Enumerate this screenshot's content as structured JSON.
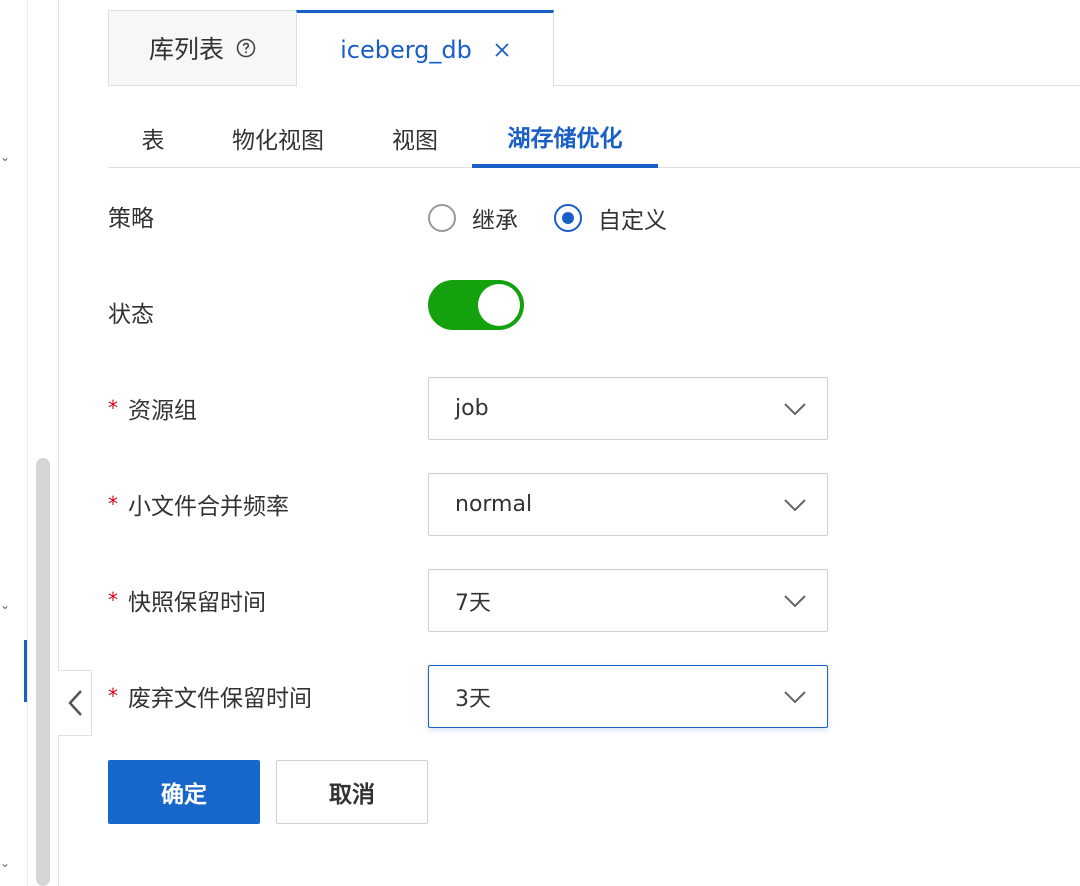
{
  "top_tabs": [
    {
      "label": "库列表"
    },
    {
      "label": "iceberg_db"
    }
  ],
  "sub_tabs": [
    {
      "label": "表"
    },
    {
      "label": "物化视图"
    },
    {
      "label": "视图"
    },
    {
      "label": "湖存储优化"
    }
  ],
  "active_sub_tab": "湖存储优化",
  "form": {
    "strategy": {
      "label": "策略",
      "options": [
        "继承",
        "自定义"
      ],
      "selected": "自定义"
    },
    "status": {
      "label": "状态",
      "enabled": true
    },
    "resource_group": {
      "required_mark": "*",
      "label": "资源组",
      "value": "job"
    },
    "small_file_merge_frequency": {
      "required_mark": "*",
      "label": "小文件合并频率",
      "value": "normal"
    },
    "snapshot_retention": {
      "required_mark": "*",
      "label": "快照保留时间",
      "value": "7天"
    },
    "orphan_file_retention": {
      "required_mark": "*",
      "label": "废弃文件保留时间",
      "value": "3天"
    }
  },
  "buttons": {
    "confirm": "确定",
    "cancel": "取消"
  },
  "colors": {
    "accent": "#1a5fc7",
    "switch_on": "#13a10e",
    "required": "#d0021b"
  }
}
